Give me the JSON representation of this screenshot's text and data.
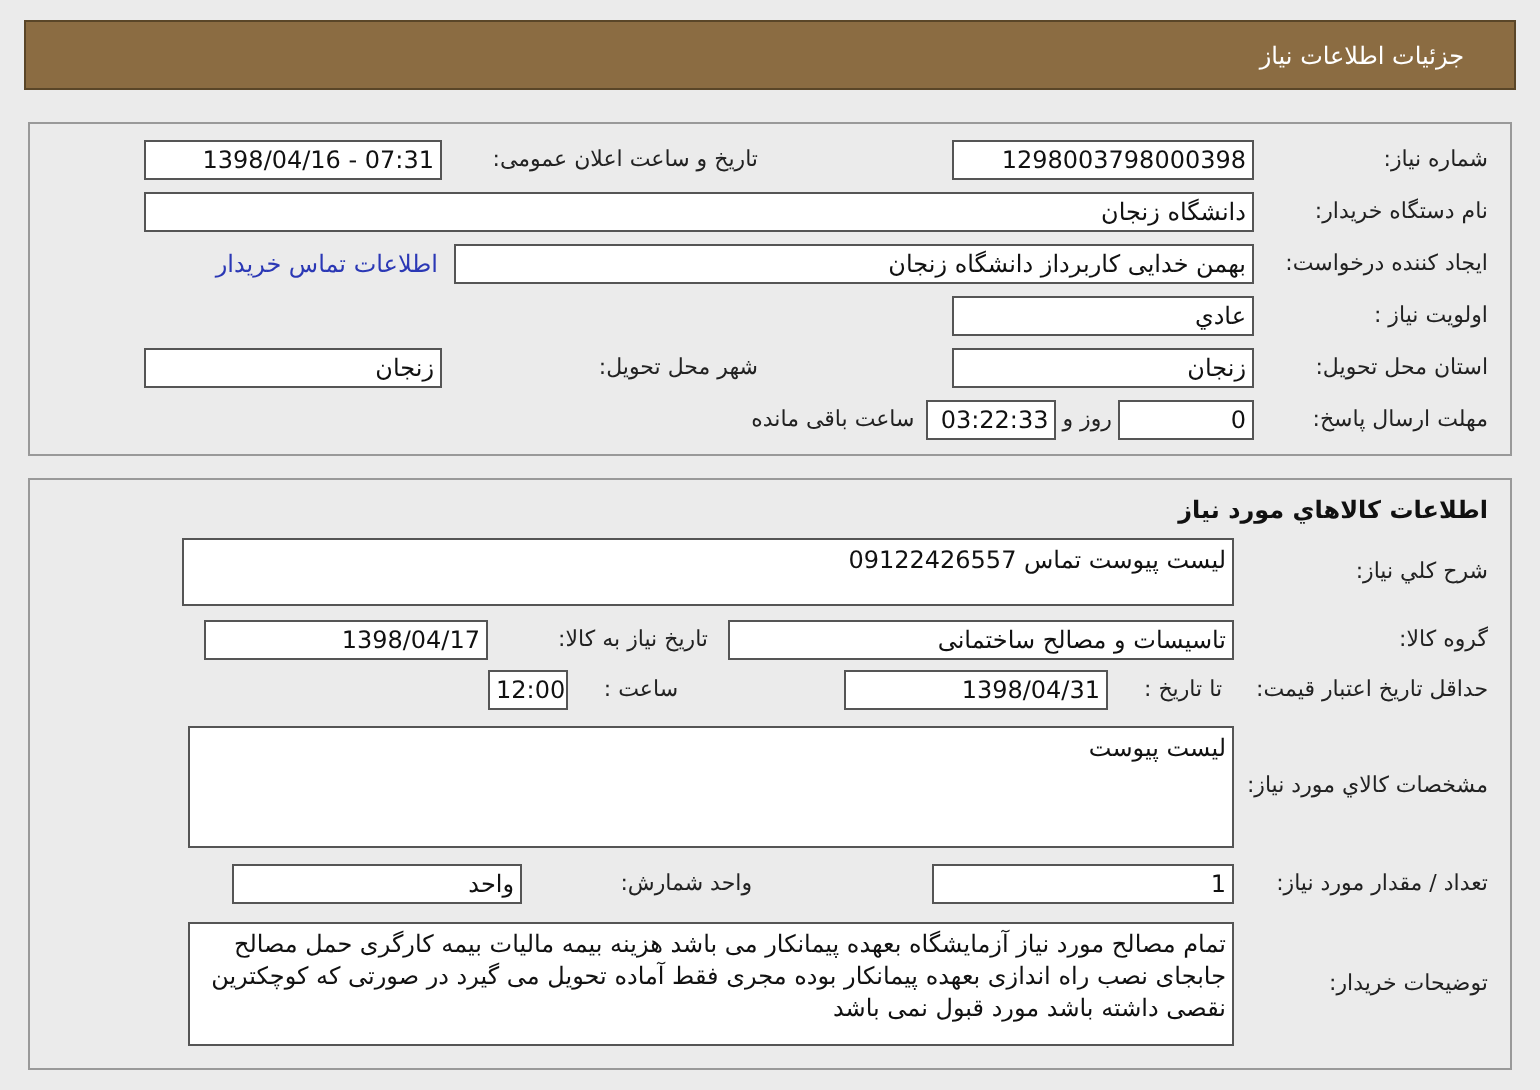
{
  "page_title": "جزئیات اطلاعات نیاز",
  "need": {
    "need_number": {
      "label": "شماره نیاز:",
      "value": "1298003798000398"
    },
    "announce_datetime": {
      "label": "تاریخ و ساعت اعلان عمومی:",
      "value": "1398/04/16 - 07:31"
    },
    "buyer_org": {
      "label": "نام دستگاه خریدار:",
      "value": "دانشگاه زنجان"
    },
    "requester": {
      "label": "ایجاد کننده درخواست:",
      "value": "بهمن خدایی کاربرداز دانشگاه زنجان",
      "contact_link": "اطلاعات تماس خریدار"
    },
    "priority": {
      "label": "اولویت نیاز :",
      "value": "عادي"
    },
    "province": {
      "label": "استان محل تحویل:",
      "value": "زنجان"
    },
    "city": {
      "label": "شهر محل تحویل:",
      "value": "زنجان"
    },
    "deadline": {
      "label": "مهلت ارسال پاسخ:",
      "days": "0",
      "days_unit": "روز و",
      "time": "03:22:33",
      "time_unit": "ساعت باقی مانده"
    }
  },
  "goods": {
    "title": "اطلاعات کالاهاي مورد نياز",
    "general_description": {
      "label": "شرح کلي نياز:",
      "value": "لیست پیوست تماس 09122426557"
    },
    "goods_group": {
      "label": "گروه کالا:",
      "value": "تاسیسات و مصالح ساختمانی"
    },
    "need_date": {
      "label": "تاریخ نیاز به کالا:",
      "value": "1398/04/17"
    },
    "price_validity": {
      "label": "حداقل تاریخ اعتبار قیمت:",
      "to_date_label": "تا تاریخ :",
      "date": "1398/04/31",
      "time_label": "ساعت :",
      "time": "12:00"
    },
    "specs": {
      "label": "مشخصات کالاي مورد نياز:",
      "value": "لیست پیوست"
    },
    "quantity": {
      "label": "تعداد / مقدار مورد نیاز:",
      "value": "1"
    },
    "unit": {
      "label": "واحد شمارش:",
      "value": "واحد"
    },
    "buyer_notes": {
      "label": "توضیحات خریدار:",
      "value": "تمام مصالح مورد نیاز  آزمایشگاه بعهده پیمانکار می باشد هزینه بیمه مالیات بیمه کارگری حمل مصالح جابجای نصب راه اندازی بعهده پیمانکار بوده مجری فقط آماده تحویل می گیرد در صورتی که کوچکترین نقصی داشته باشد مورد قبول نمی باشد"
    }
  }
}
